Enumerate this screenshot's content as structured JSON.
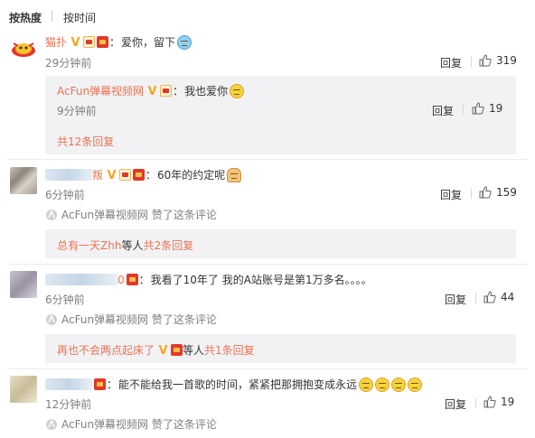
{
  "sort": {
    "hot": "按热度",
    "time": "按时间"
  },
  "c1": {
    "name": "猫扑",
    "sep": "：",
    "text": "爱你，留下",
    "time": "29分钟前",
    "reply": "回复",
    "likes": "319",
    "sub": {
      "name": "AcFun弹幕视频网",
      "sep": "：",
      "text": "我也爱你",
      "time": "9分钟前",
      "reply": "回复",
      "likes": "19"
    },
    "more": "共12条回复"
  },
  "c2": {
    "name_visible": "叛",
    "sep": "：",
    "text": "60年的约定呢",
    "time": "6分钟前",
    "reply": "回复",
    "likes": "159",
    "liked_by": "AcFun弹幕视频网 赞了这条评论",
    "replies_prefix": "总有一天Zhh",
    "replies_mid": " 等人 ",
    "replies_link": "共2条回复"
  },
  "c3": {
    "name_visible": "0",
    "sep": "：",
    "text": "我看了10年了 我的A站账号是第1万多名。。。。",
    "time": "6分钟前",
    "reply": "回复",
    "likes": "44",
    "liked_by": "AcFun弹幕视频网 赞了这条评论",
    "replies_prefix": "再也不会两点起床了",
    "replies_mid": " 等人 ",
    "replies_link": "共1条回复"
  },
  "c4": {
    "sep": "：",
    "text": "能不能给我一首歌的时间，紧紧把那拥抱变成永远",
    "time": "12分钟前",
    "reply": "回复",
    "likes": "19",
    "liked_by": "AcFun弹幕视频网 赞了这条评论"
  },
  "icons": [
    "verified-v-icon",
    "vip-badge-icon",
    "red-badge-icon",
    "thumb-up-icon",
    "emoji-icon",
    "acfun-logo-icon"
  ]
}
